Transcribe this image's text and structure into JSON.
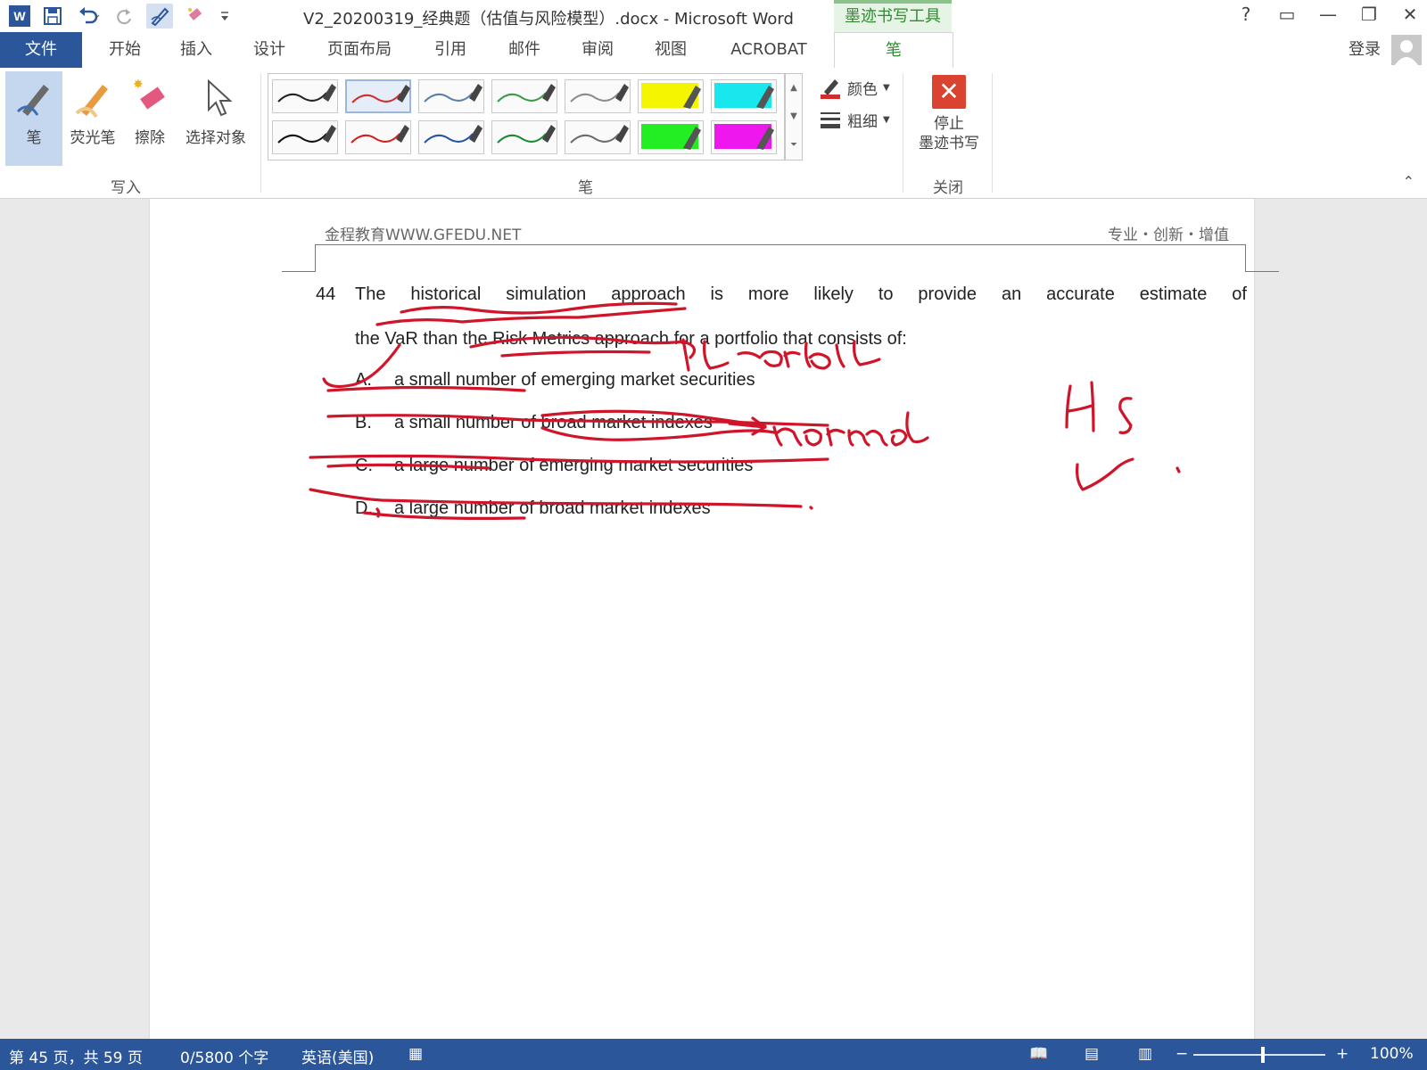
{
  "app": {
    "title": "V2_20200319_经典题（估值与风险模型）.docx - Microsoft Word",
    "contextual_tab": "墨迹书写工具",
    "login": "登录",
    "help": "?"
  },
  "ribbon_tabs": [
    "文件",
    "开始",
    "插入",
    "设计",
    "页面布局",
    "引用",
    "邮件",
    "审阅",
    "视图",
    "ACROBAT",
    "笔"
  ],
  "ribbon": {
    "write_group": {
      "label": "写入",
      "buttons": [
        "笔",
        "荧光笔",
        "擦除",
        "选择对象"
      ]
    },
    "pens_group": {
      "label": "笔",
      "pens": [
        {
          "color": "#222222",
          "type": "pen"
        },
        {
          "color": "#d22d2d",
          "type": "pen",
          "selected": true
        },
        {
          "color": "#5a7fa8",
          "type": "pen"
        },
        {
          "color": "#3a9a4a",
          "type": "pen"
        },
        {
          "color": "#8c8c8c",
          "type": "pen"
        },
        {
          "color": "#f5f500",
          "type": "highlighter"
        },
        {
          "color": "#18e8ee",
          "type": "highlighter"
        },
        {
          "color": "#111111",
          "type": "pen"
        },
        {
          "color": "#d22020",
          "type": "pen"
        },
        {
          "color": "#2855a0",
          "type": "pen"
        },
        {
          "color": "#1a8a30",
          "type": "pen"
        },
        {
          "color": "#6b6b6b",
          "type": "pen"
        },
        {
          "color": "#22ee22",
          "type": "highlighter"
        },
        {
          "color": "#ee18ee",
          "type": "highlighter"
        }
      ],
      "color_label": "颜色",
      "thickness_label": "粗细"
    },
    "close_group": {
      "label": "关闭",
      "stop_label_1": "停止",
      "stop_label_2": "墨迹书写"
    }
  },
  "document": {
    "header_left": "金程教育WWW.GFEDU.NET",
    "header_right": "专业・创新・增值",
    "question_number": "44",
    "question_line1": "The historical simulation approach is more likely to provide an accurate estimate of",
    "question_line2": "the VaR than the Risk Metrics approach for a portfolio that consists of:",
    "options": [
      {
        "letter": "A.",
        "text": "a small number of emerging market securities"
      },
      {
        "letter": "B.",
        "text": "a small number of broad market indexes"
      },
      {
        "letter": "C.",
        "text": "a large number of emerging market securities"
      },
      {
        "letter": "D.",
        "text": "a large number of broad market indexes"
      }
    ],
    "ink_color": "#d0142a"
  },
  "status_bar": {
    "page_info": "第 45 页，共 59 页",
    "word_count": "0/5800 个字",
    "language": "英语(美国)",
    "zoom": "100%",
    "zoom_minus": "−",
    "zoom_plus": "+"
  }
}
